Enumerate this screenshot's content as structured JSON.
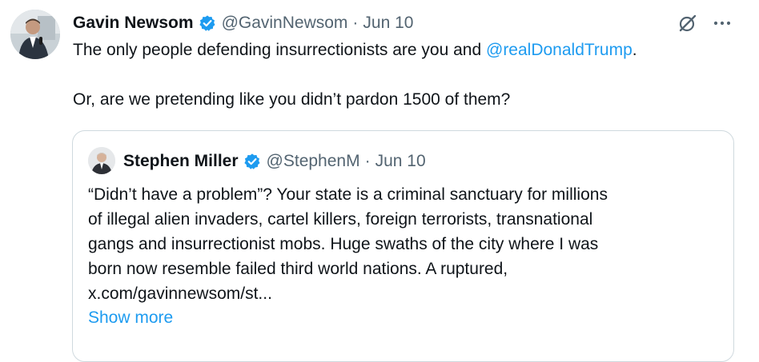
{
  "tweet": {
    "author_name": "Gavin Newsom",
    "handle": "@GavinNewsom",
    "separator": "·",
    "date": "Jun 10",
    "text_part1": "The only people defending insurrectionists are you and ",
    "mention": "@realDonaldTrump",
    "text_part2": ".",
    "text_line2": "Or, are we pretending like you didn’t pardon 1500 of them?",
    "icons": [
      "avatar",
      "verified-badge-icon",
      "grok-icon",
      "more-icon"
    ],
    "colors": {
      "link": "#1d9bf0",
      "secondary_text": "#536471",
      "verified": "#1d9bf0"
    }
  },
  "quote": {
    "author_name": "Stephen Miller",
    "handle": "@StephenM",
    "separator": "·",
    "date": "Jun 10",
    "lines": [
      "“Didn’t have a problem”? Your state is a criminal sanctuary for millions",
      "of illegal alien invaders, cartel killers, foreign terrorists, transnational",
      "gangs and insurrectionist mobs. Huge swaths of the city where I was",
      "born now resemble failed third world nations. A ruptured,",
      "x.com/gavinnewsom/st..."
    ],
    "show_more": "Show more"
  }
}
